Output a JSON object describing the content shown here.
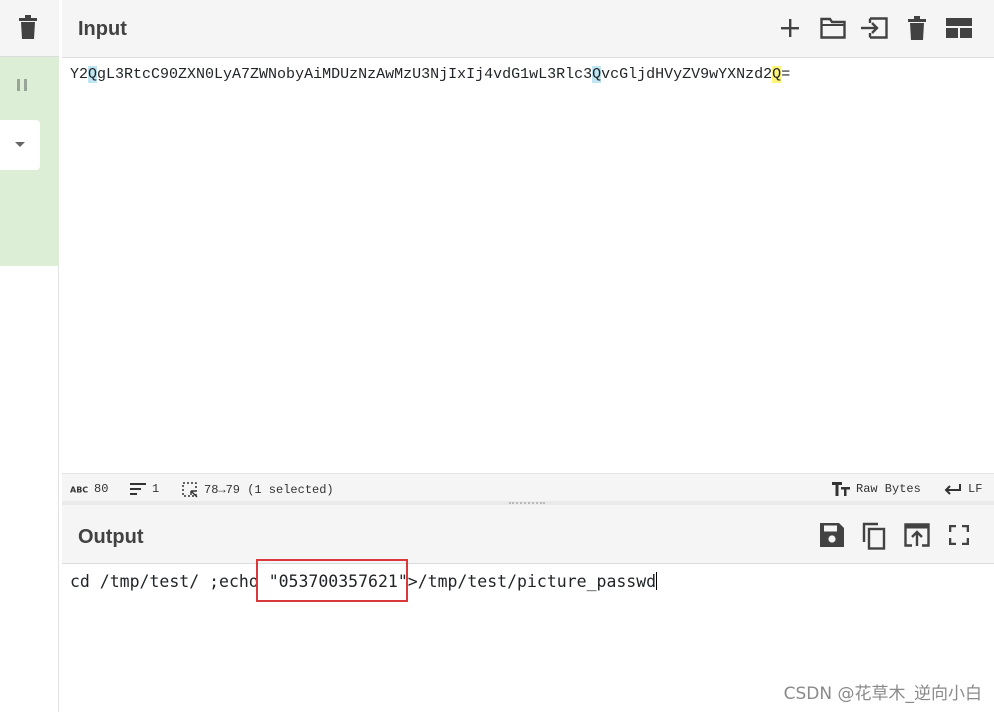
{
  "input": {
    "title": "Input",
    "text_parts": [
      {
        "t": "Y2",
        "hl": ""
      },
      {
        "t": "Q",
        "hl": "blue"
      },
      {
        "t": "gL3RtcC90ZXN0LyA7ZWNobyAiMDUzNzAwMzU3NjIxIj4vdG1wL3Rlc3",
        "hl": ""
      },
      {
        "t": "Q",
        "hl": "blue"
      },
      {
        "t": "vcGljdHVyZV9wYXNzd2",
        "hl": ""
      },
      {
        "t": "Q",
        "hl": "yellow"
      },
      {
        "t": "=",
        "hl": ""
      }
    ]
  },
  "status": {
    "length": "80",
    "lines": "1",
    "selection": "78→79 (1 selected)",
    "encoding": "Raw Bytes",
    "eol": "LF"
  },
  "output": {
    "title": "Output",
    "before": "cd /tmp/test/ ;echo ",
    "highlighted": "\"053700357621\"",
    "after": ">/tmp/test/picture_passwd"
  },
  "watermark": "CSDN @花草木_逆向小白",
  "icons": [
    "trash-icon",
    "pause-icon",
    "caret-down-icon",
    "add-icon",
    "folder-icon",
    "import-icon",
    "delete-icon",
    "layout-icon",
    "text-length-icon",
    "lines-icon",
    "selection-icon",
    "text-encoding-icon",
    "eol-icon",
    "save-icon",
    "copy-icon",
    "replace-input-icon",
    "fullscreen-icon"
  ]
}
